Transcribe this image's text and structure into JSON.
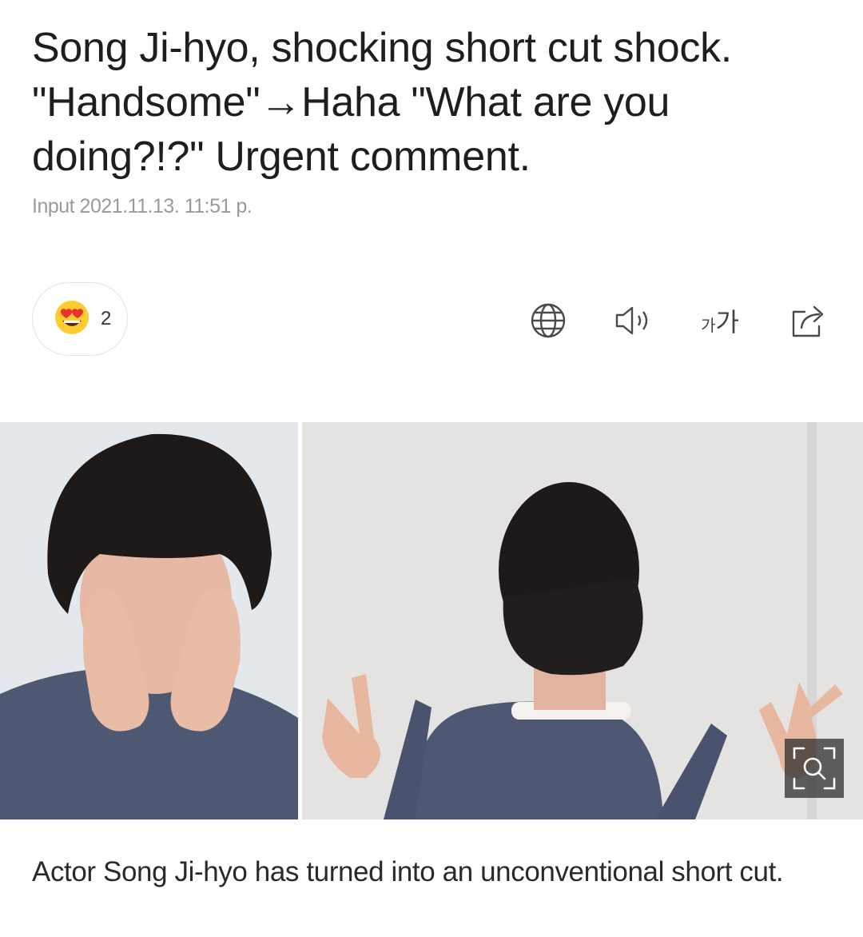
{
  "article": {
    "headline_lines": [
      "Song Ji-hyo, shocking short cut shock.",
      "\"Handsome\"→Haha \"What are you",
      "doing?!?\" Urgent comment."
    ],
    "input_time": "Input 2021.11.13. 11:51 p.",
    "reaction": {
      "icon": "heart-eyes-emoji-icon",
      "count": "2"
    },
    "toolbar": {
      "icons": [
        "globe-icon",
        "speaker-icon",
        "font-size-icon",
        "share-icon"
      ],
      "font_size_small": "가",
      "font_size_big": "가"
    },
    "photo": {
      "zoom_icon": "zoom-search-icon"
    },
    "caption": "Actor Song Ji-hyo has turned into an unconventional short cut."
  },
  "colors": {
    "text": "#1e1e1e",
    "meta": "#9a9a9a",
    "border": "#e3e3e3",
    "emoji_face": "#ffcc2f",
    "emoji_heart": "#e8322d",
    "sweater": "#4f5873",
    "hair": "#1d1a19",
    "wall_left": "#e4e7ec",
    "wall_right": "#e5e3e1"
  }
}
